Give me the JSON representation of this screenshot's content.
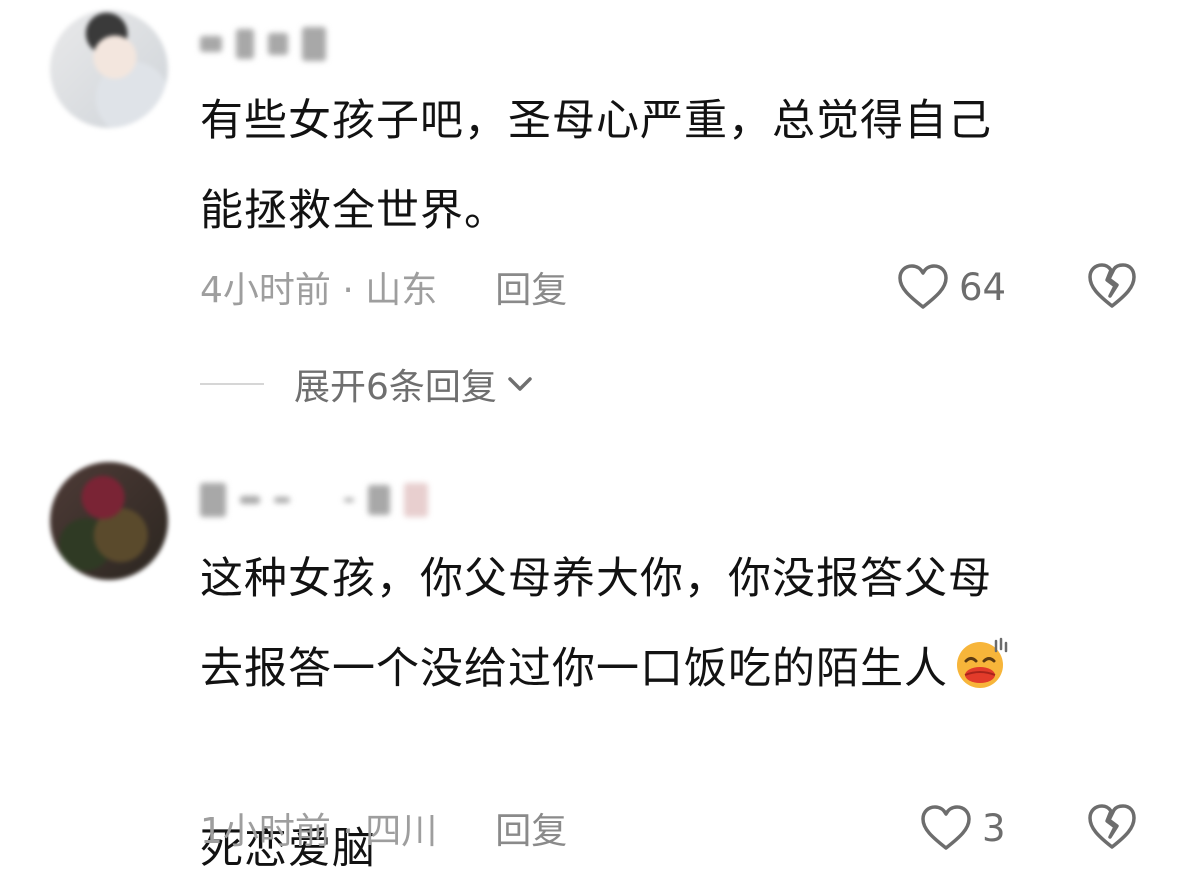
{
  "comments": [
    {
      "username_hidden": true,
      "text": "有些女孩子吧，圣母心严重，总觉得自己\n能拯救全世界。",
      "time_location": "4小时前 · 山东",
      "reply_label": "回复",
      "likes": "64",
      "expand_replies_label": "展开6条回复"
    },
    {
      "username_hidden": true,
      "text": "这种女孩，你父母养大你，你没报答父母\n去报答一个没给过你一口饭吃的陌生人",
      "text_after_emoji": "死恋爱脑",
      "emoji": "face-with-steam-emoji",
      "time_location": "1小时前 · 四川",
      "reply_label": "回复",
      "likes": "3"
    }
  ],
  "icons": {
    "like": "heart-outline-icon",
    "dislike": "broken-heart-icon",
    "expand": "chevron-down-icon"
  },
  "colors": {
    "background": "#ffffff",
    "text": "#121212",
    "meta": "#9e9e9e",
    "icon": "#6d6d6d",
    "emoji_face": "#f7b53a",
    "emoji_lips": "#e23b2a"
  }
}
